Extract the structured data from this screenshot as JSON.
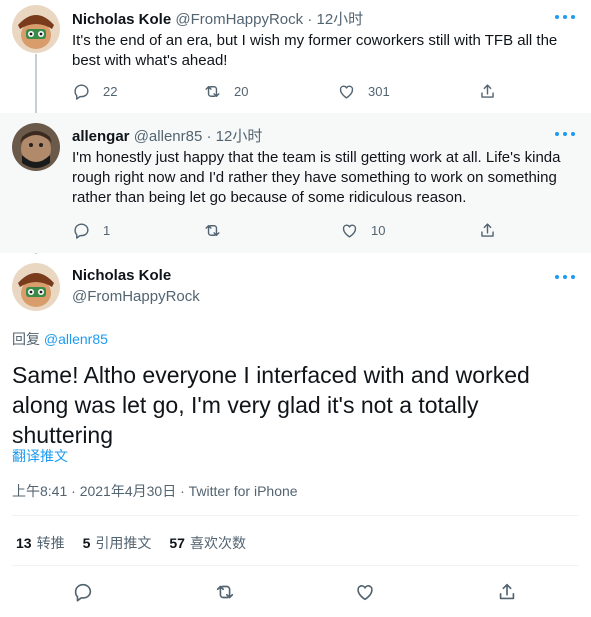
{
  "tweets": [
    {
      "name": "Nicholas Kole",
      "handle": "@FromHappyRock",
      "time": "12小时",
      "sep": "·",
      "text": "It's the end of an era, but I wish my former coworkers still with TFB all the best with what's ahead!",
      "replies": "22",
      "retweets": "20",
      "likes": "301"
    },
    {
      "name": "allengar",
      "handle": "@allenr85",
      "time": "12小时",
      "sep": "·",
      "text": "I'm honestly just happy that the team is still getting work at all. Life's kinda rough right now and I'd rather they have something to work on something rather than being let go because of some ridiculous reason.",
      "replies": "1",
      "retweets": "",
      "likes": "10"
    }
  ],
  "main": {
    "name": "Nicholas Kole",
    "handle": "@FromHappyRock",
    "reply_prefix": "回复",
    "reply_handle": "@allenr85",
    "text": "Same! Altho everyone I interfaced with and worked along was let go, I'm very glad it's not a totally shuttering",
    "translate": "翻译推文",
    "timestamp": "上午8:41 · 2021年4月30日 · Twitter for iPhone",
    "stats": {
      "retweets_count": "13",
      "retweets_label": "转推",
      "quotes_count": "5",
      "quotes_label": "引用推文",
      "likes_count": "57",
      "likes_label": "喜欢次数"
    }
  },
  "colors": {
    "accent": "#1d9bf0",
    "muted": "#536471",
    "text": "#0f1419",
    "highlight_bg": "#f7f9f9"
  }
}
